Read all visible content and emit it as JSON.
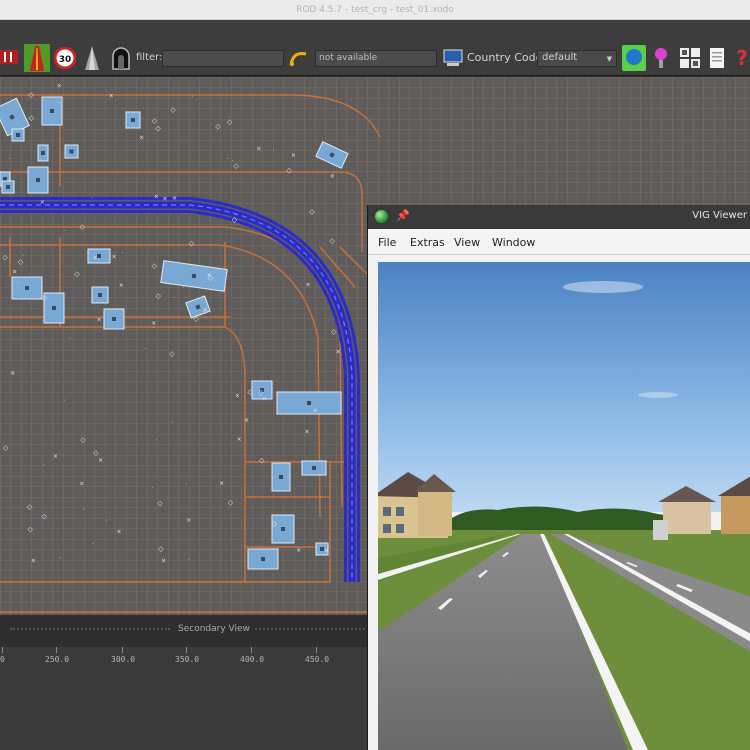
{
  "window": {
    "title": "ROD 4.5.7 - test_crg - test_01.xodo"
  },
  "toolbar": {
    "filter_label": "filter:",
    "filter_value": "",
    "not_available": "not available",
    "country_code_label": "Country Code:",
    "country_code_value": "default",
    "speed_sign": "30",
    "icons": [
      "road-icon",
      "highway-icon",
      "speed-limit-icon",
      "cone-icon",
      "tunnel-icon",
      "signal-icon",
      "monitor-icon",
      "globe-button-icon",
      "pink-pin-icon",
      "grid-icon",
      "document-icon",
      "help-icon"
    ]
  },
  "secondary_view": {
    "label": "Secondary View"
  },
  "ruler": {
    "ticks": [
      "0",
      "250.0",
      "300.0",
      "350.0",
      "400.0",
      "450.0"
    ]
  },
  "vig": {
    "title": "VIG Viewer",
    "menu": {
      "file": "File",
      "extras": "Extras",
      "view": "View",
      "window": "Window"
    }
  },
  "colors": {
    "road_blue": "#2b2bc8",
    "grid_orange": "#c8703a",
    "panel_dark": "#3d3d3d",
    "sky_top": "#4f86c4"
  }
}
